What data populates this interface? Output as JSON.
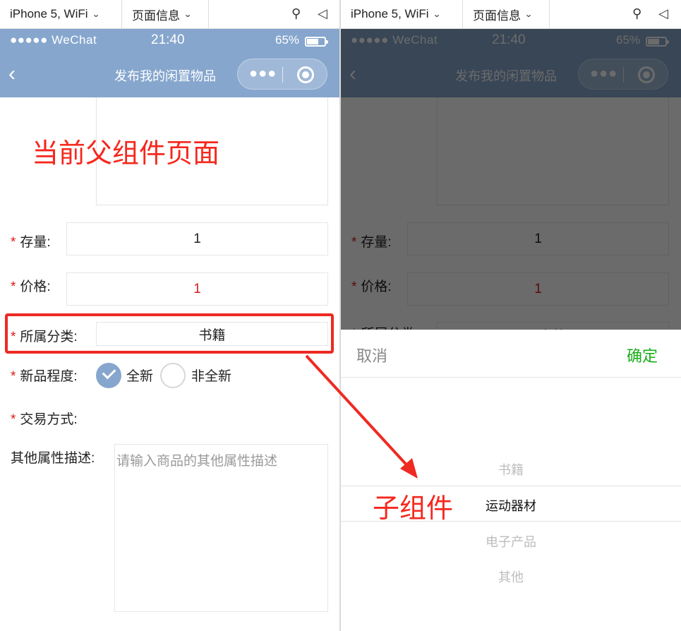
{
  "toolbar": {
    "device_label": "iPhone 5, WiFi",
    "page_label": "页面信息"
  },
  "status": {
    "carrier": "●●●●● WeChat",
    "time": "21:40",
    "battery": "65%",
    "battery_level": 0.65
  },
  "nav": {
    "title": "发布我的闲置物品",
    "back_icon": "chevron-left-icon"
  },
  "annotations": {
    "parent": "当前父组件页面",
    "child": "子组件"
  },
  "form": {
    "stock_label": "存量:",
    "stock_value": "1",
    "price_label": "价格:",
    "price_value": "1",
    "category_label": "所属分类:",
    "category_value": "书籍",
    "condition_label": "新品程度:",
    "condition_options": [
      "全新",
      "非全新"
    ],
    "condition_selected": "全新",
    "trade_label": "交易方式:",
    "desc_label": "其他属性描述:",
    "desc_placeholder": "请输入商品的其他属性描述",
    "required_mark": "*"
  },
  "picker": {
    "cancel_label": "取消",
    "confirm_label": "确定",
    "options": [
      "书籍",
      "运动器材",
      "电子产品",
      "其他"
    ],
    "selected": "运动器材"
  },
  "colors": {
    "nav_bg": "#86a6cd",
    "annotation": "#f5281e",
    "confirm": "#1aad19",
    "required": "#e01818"
  }
}
